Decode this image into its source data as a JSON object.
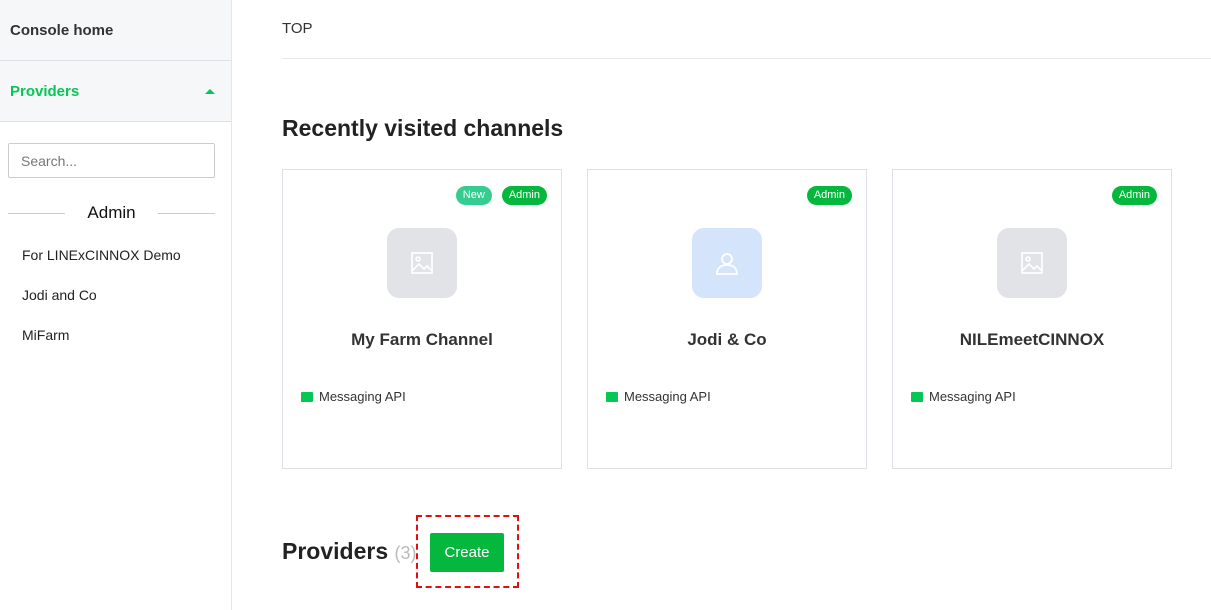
{
  "sidebar": {
    "console_home": "Console home",
    "providers": "Providers",
    "search_placeholder": "Search...",
    "group": "Admin",
    "items": [
      "For LINExCINNOX Demo",
      "Jodi and Co",
      "MiFarm"
    ]
  },
  "main": {
    "breadcrumb": "TOP",
    "recent_title": "Recently visited channels",
    "cards": [
      {
        "name": "My Farm Channel",
        "type": "Messaging API",
        "badge_new": "New",
        "badge_role": "Admin",
        "icon": "image-icon"
      },
      {
        "name": "Jodi & Co",
        "type": "Messaging API",
        "badge_role": "Admin",
        "icon": "user-icon"
      },
      {
        "name": "NILEmeetCINNOX",
        "type": "Messaging API",
        "badge_role": "Admin",
        "icon": "image-icon"
      }
    ],
    "providers_title": "Providers",
    "providers_count": "(3)",
    "create_label": "Create"
  },
  "colors": {
    "accent": "#06c755",
    "button": "#06b73d"
  }
}
